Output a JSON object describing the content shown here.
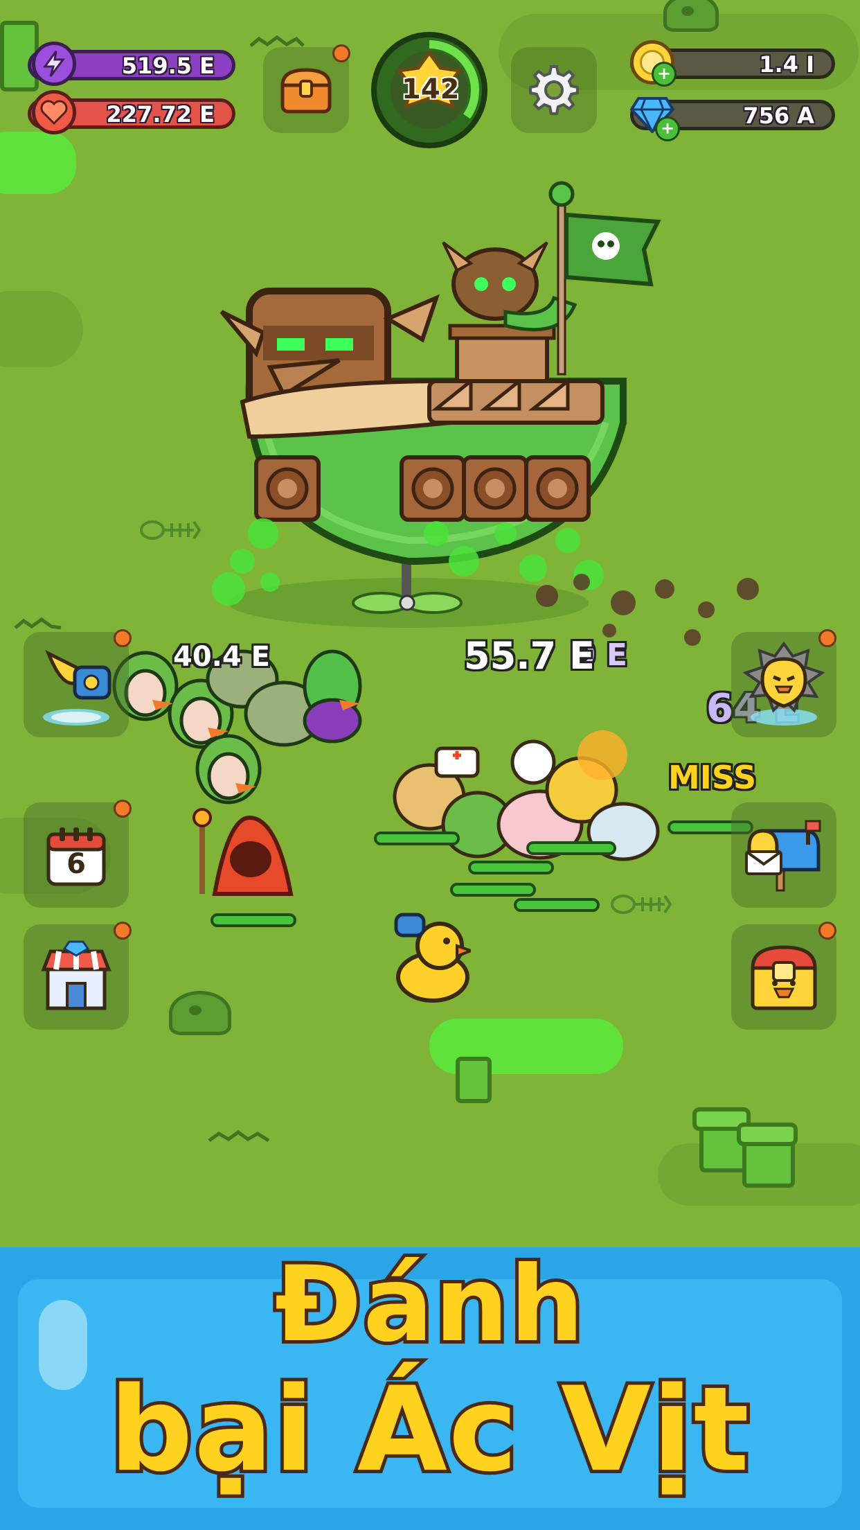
{
  "hud": {
    "energy": "519.5 E",
    "health": "227.72 E",
    "level": "142",
    "gold": "1.4 I",
    "gems": "756 A"
  },
  "icons": {
    "energy": "lightning-icon",
    "health": "heart-icon",
    "chest": "chest-icon",
    "level": "star-badge-icon",
    "settings": "gear-icon",
    "gold": "coin-plus-icon",
    "gems": "diamond-plus-icon",
    "summon": "horn-portal-icon",
    "calendar": "calendar-icon",
    "shop": "shop-icon",
    "boss": "duck-boss-icon",
    "mail": "mailbox-icon",
    "treasure": "duck-chest-icon"
  },
  "side": {
    "calendar_day": "6"
  },
  "combat": {
    "damage_left": "40.4 E",
    "damage_center": "55.7 E",
    "damage_center_ghost": "9 E",
    "damage_right": "64 E",
    "miss": "MISS"
  },
  "banner": {
    "line1": "Đánh",
    "line2": "bại Ác Vịt"
  },
  "colors": {
    "field": "#80b439",
    "goo": "#5fe23a",
    "energy_bar": "#8b3fc1",
    "health_bar": "#e4534a",
    "level_ring": "#2f9a2a",
    "banner_bg": "#2aa6e8",
    "headline": "#ffd21f",
    "notification_dot": "#f47a2b"
  }
}
